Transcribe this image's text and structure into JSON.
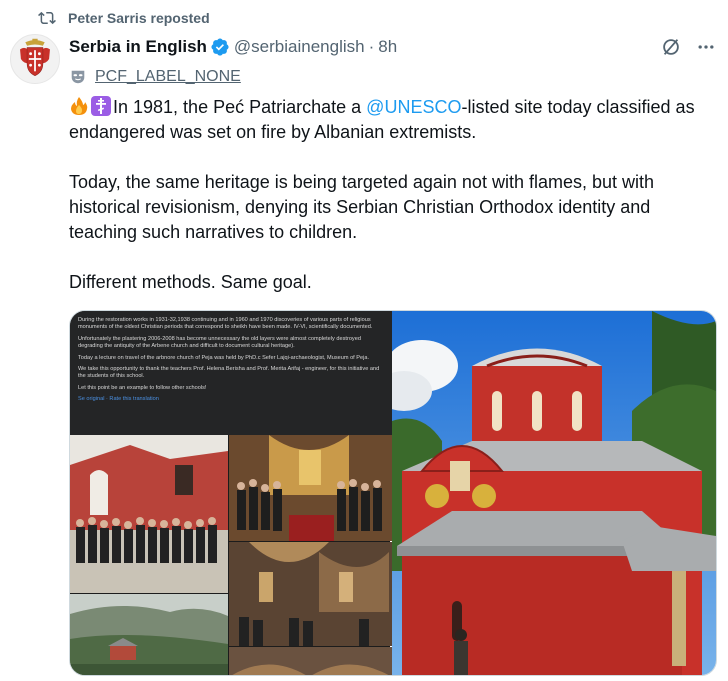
{
  "repost": {
    "text": "Peter Sarris reposted",
    "icon": "repost-icon"
  },
  "author": {
    "display_name": "Serbia in English",
    "handle": "@serbiainenglish",
    "separator": "·",
    "time": "8h",
    "avatar": "coat-of-arms-avatar",
    "verified": true
  },
  "label": {
    "text": "PCF_LABEL_NONE",
    "icon": "theater-mask-icon"
  },
  "tweet": {
    "line1_before": "In 1981, the Peć Patriarchate  a ",
    "line1_mention": "@UNESCO",
    "line1_after": "-listed site today classified as endangered was set on fire by Albanian extremists.",
    "para2": "Today, the same heritage is being targeted again not with flames, but with historical revisionism, denying its Serbian Christian Orthodox identity and teaching such narratives to children.",
    "para3": "Different methods. Same goal.",
    "emojis": [
      "fire-emoji",
      "orthodox-cross-emoji"
    ]
  },
  "media": {
    "left": {
      "screenshot_paragraphs": [
        "During the restoration works in 1931-32,1938 continuing and in 1960 and 1970 discoveries of various parts of religious monuments of the oldest Christian periods that correspond to sheikh have been made. IV-VI, scientifically documented.",
        "Unfortunately the plastering 2006-2008 has become unnecessary the old layers were almost completely destroyed degrading the antiquity of the Arbene church and difficult to document cultural heritage).",
        "Today a lecture on travel of the arbnore church of Peja was held by PhD.c Sefer Lajqi-archaeologist, Museum of Peja.",
        "We take this opportunity to thank the teachers Prof. Helena Berisha and Prof. Merita Arifaj - engineer, for this initiative and the students of this school.",
        "Let this point be an example to follow other schools!"
      ],
      "see_original": "Se original · Rate this translation"
    },
    "right": {
      "alt": "monastery-photo"
    }
  },
  "colors": {
    "accent": "#1d9bf0",
    "verified": "#1d9bf0",
    "muted": "#536471",
    "church_red": "#c8312a"
  }
}
